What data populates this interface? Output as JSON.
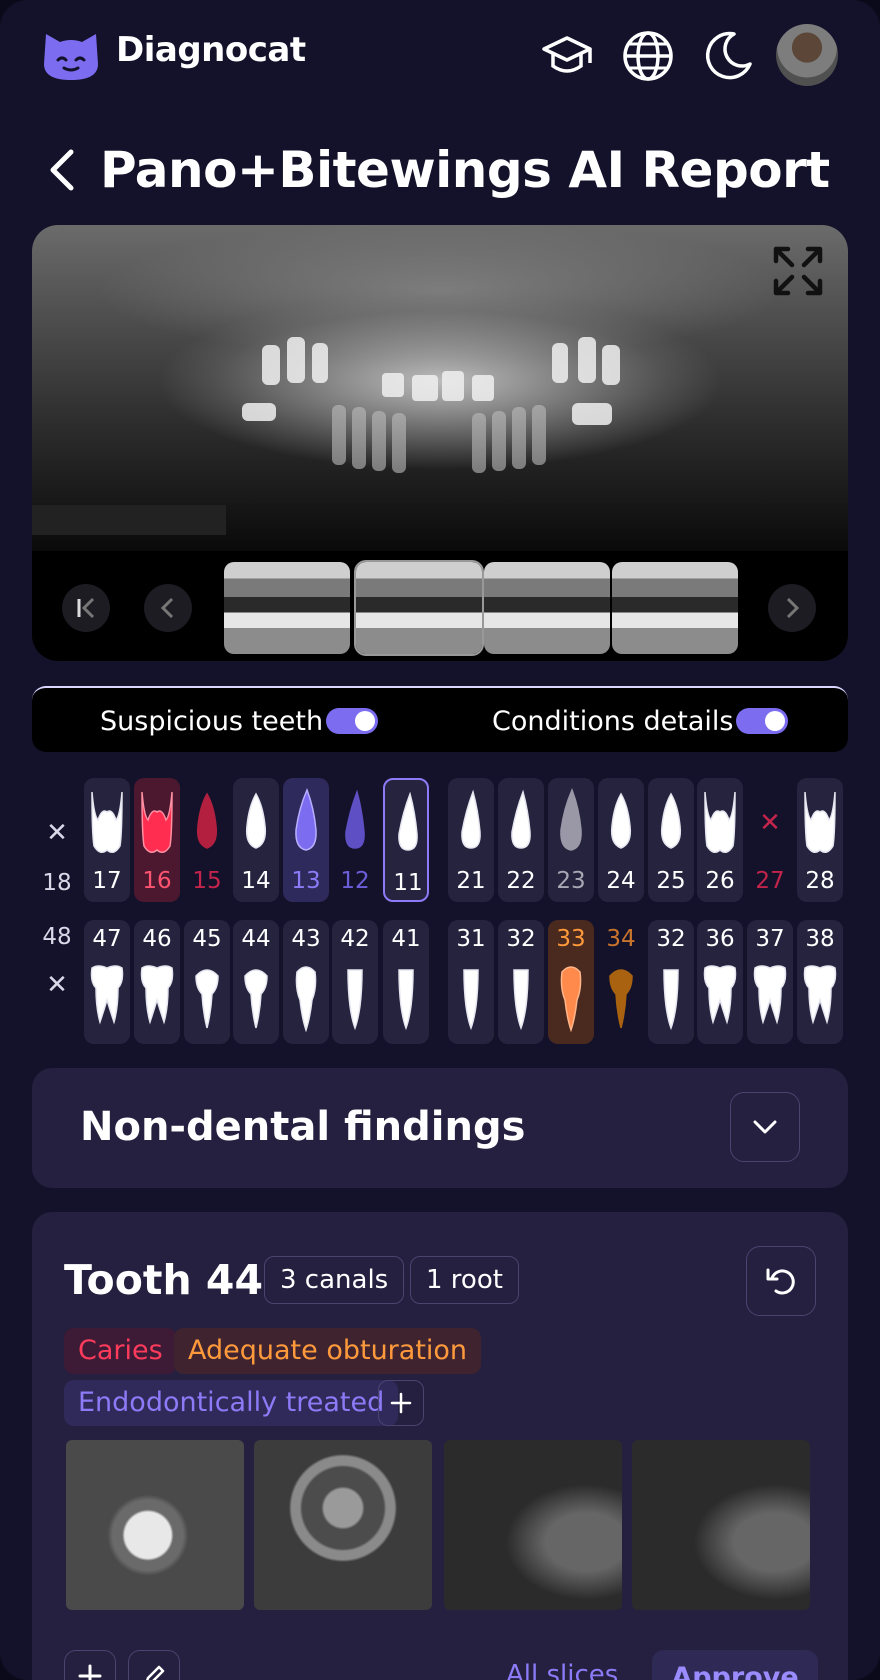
{
  "app": {
    "name": "Diagnocat"
  },
  "header": {
    "icons": [
      "graduation-cap-icon",
      "globe-icon",
      "moon-icon"
    ]
  },
  "page": {
    "title": "Pano+Bitewings AI Report"
  },
  "toggles": [
    {
      "label": "Suspicious teeth",
      "on": true
    },
    {
      "label": "Conditions details",
      "on": true
    }
  ],
  "chart": {
    "upper": [
      {
        "num": "17",
        "state": "normal",
        "type": "molar"
      },
      {
        "num": "16",
        "state": "caries",
        "type": "molar"
      },
      {
        "num": "15",
        "state": "pink-text",
        "type": "premolar"
      },
      {
        "num": "14",
        "state": "normal",
        "type": "premolar"
      },
      {
        "num": "13",
        "state": "purple",
        "type": "canine"
      },
      {
        "num": "12",
        "state": "purple-text",
        "type": "incisor"
      },
      {
        "num": "11",
        "state": "selected",
        "type": "incisor"
      },
      {
        "num": "21",
        "state": "normal",
        "type": "incisor"
      },
      {
        "num": "22",
        "state": "normal",
        "type": "incisor"
      },
      {
        "num": "23",
        "state": "gray",
        "type": "canine"
      },
      {
        "num": "24",
        "state": "normal",
        "type": "premolar"
      },
      {
        "num": "25",
        "state": "normal",
        "type": "premolar"
      },
      {
        "num": "26",
        "state": "normal",
        "type": "molar"
      },
      {
        "num": "27",
        "state": "missing",
        "type": "none"
      },
      {
        "num": "28",
        "state": "normal",
        "type": "molar"
      }
    ],
    "upper_left_label": "18",
    "lower": [
      {
        "num": "47",
        "state": "normal",
        "type": "molar"
      },
      {
        "num": "46",
        "state": "normal",
        "type": "molar"
      },
      {
        "num": "45",
        "state": "normal",
        "type": "premolar"
      },
      {
        "num": "44",
        "state": "normal",
        "type": "premolar"
      },
      {
        "num": "43",
        "state": "normal",
        "type": "canine"
      },
      {
        "num": "42",
        "state": "normal",
        "type": "incisor"
      },
      {
        "num": "41",
        "state": "normal",
        "type": "incisor"
      },
      {
        "num": "31",
        "state": "normal",
        "type": "incisor"
      },
      {
        "num": "32",
        "state": "normal",
        "type": "incisor"
      },
      {
        "num": "33",
        "state": "orange",
        "type": "canine"
      },
      {
        "num": "34",
        "state": "brown",
        "type": "premolar"
      },
      {
        "num": "32",
        "state": "normal",
        "type": "incisor"
      },
      {
        "num": "36",
        "state": "normal",
        "type": "molar"
      },
      {
        "num": "37",
        "state": "normal",
        "type": "molar"
      },
      {
        "num": "38",
        "state": "normal",
        "type": "molar"
      }
    ],
    "lower_left_label": "48"
  },
  "non_dental": {
    "title": "Non-dental findings"
  },
  "tooth": {
    "title": "Tooth 44",
    "canals": "3 canals",
    "roots": "1 root",
    "tags": [
      {
        "label": "Caries",
        "color": "#ff3b5c"
      },
      {
        "label": "Adequate obturation",
        "color": "#ff9a3c"
      },
      {
        "label": "Endodontically treated",
        "color": "#8b7bf7"
      }
    ]
  },
  "actions": {
    "all_slices": "All slices",
    "approve": "Approve"
  },
  "colors": {
    "accent": "#7c6cf0",
    "caries": "#ff2d4f",
    "orange": "#ff8a4c",
    "brown": "#a9620f"
  }
}
